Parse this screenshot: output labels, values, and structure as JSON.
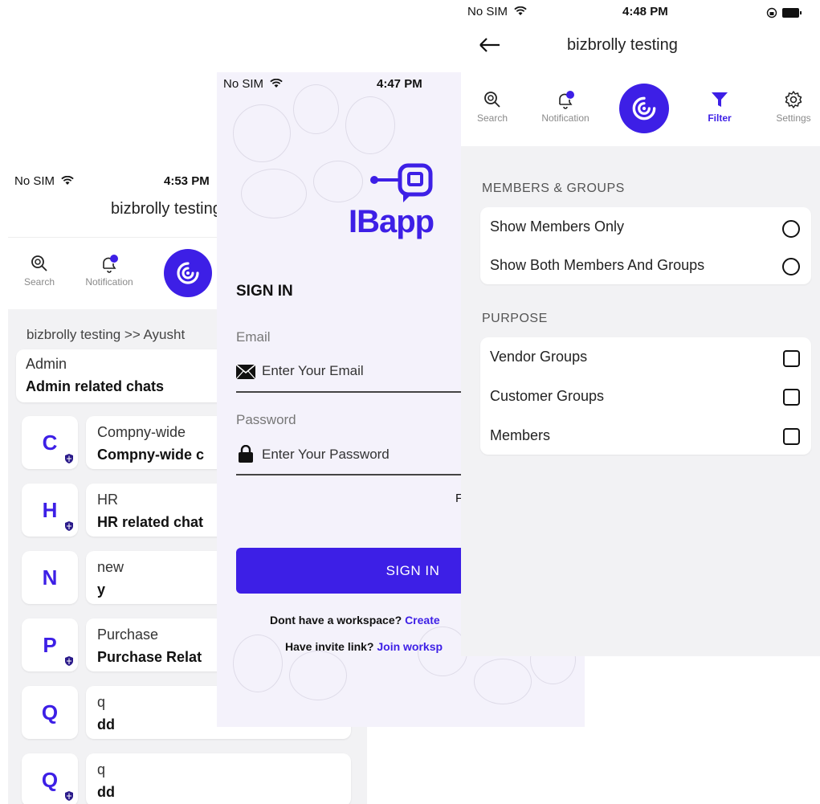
{
  "screen_chat": {
    "status": {
      "carrier": "No SIM",
      "time": "4:53 PM"
    },
    "header_title": "bizbrolly testing",
    "nav": {
      "search": "Search",
      "notification": "Notification"
    },
    "breadcrumb": "bizbrolly testing >> Ayusht",
    "admin_card": {
      "title": "Admin",
      "subtitle": "Admin related chats"
    },
    "chats": [
      {
        "letter": "C",
        "title": "Compny-wide",
        "subtitle": "Compny-wide c"
      },
      {
        "letter": "H",
        "title": "HR",
        "subtitle": "HR related chat"
      },
      {
        "letter": "N",
        "title": "new",
        "subtitle": "y"
      },
      {
        "letter": "P",
        "title": "Purchase",
        "subtitle": "Purchase Relat"
      },
      {
        "letter": "Q",
        "title": "q",
        "subtitle": "dd"
      },
      {
        "letter": "Q",
        "title": "q",
        "subtitle": "dd"
      }
    ]
  },
  "screen_signin": {
    "status": {
      "carrier": "No SIM",
      "time": "4:47 PM"
    },
    "logo_text": "IBapp",
    "heading": "SIGN IN",
    "email_label": "Email",
    "email_placeholder": "Enter Your Email",
    "password_label": "Password",
    "password_placeholder": "Enter Your Password",
    "forgot_fragment": "F",
    "signin_button": "SIGN IN",
    "no_workspace_text": "Dont have a workspace?",
    "create_link": "Create",
    "invite_text": "Have invite link?",
    "join_link": "Join worksp"
  },
  "screen_filter": {
    "status": {
      "carrier": "No SIM",
      "time": "4:48 PM"
    },
    "header_title": "bizbrolly testing",
    "nav": {
      "search": "Search",
      "notification": "Notification",
      "filter": "Filter",
      "settings": "Settings"
    },
    "members_groups_title": "MEMBERS & GROUPS",
    "members_groups_options": [
      "Show Members Only",
      "Show Both Members And Groups"
    ],
    "purpose_title": "PURPOSE",
    "purpose_options": [
      "Vendor Groups",
      "Customer Groups",
      "Members"
    ]
  },
  "colors": {
    "accent": "#3d1fe6",
    "background": "#f2f2f4"
  }
}
